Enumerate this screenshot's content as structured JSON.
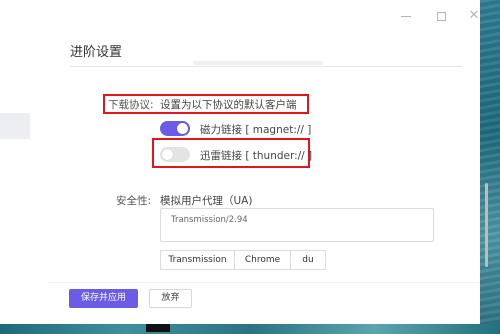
{
  "dialog": {
    "title": "进阶设置",
    "window_buttons": {
      "minimize": "",
      "maximize": "",
      "close": "✕"
    }
  },
  "protocol": {
    "label": "下载协议:",
    "description": "设置为以下协议的默认客户端",
    "options": [
      {
        "label": "磁力链接 [ magnet:// ]",
        "enabled": true
      },
      {
        "label": "迅雷链接 [ thunder:// ]",
        "enabled": false
      }
    ]
  },
  "security": {
    "label": "安全性:",
    "ua_title": "模拟用户代理（UA)",
    "ua_value": "Transmission/2.94",
    "presets": [
      "Transmission",
      "Chrome",
      "du"
    ]
  },
  "footer": {
    "save_label": "保存并应用",
    "discard_label": "放弃"
  },
  "colors": {
    "accent": "#6a5ce6",
    "highlight_box": "#e3151a"
  }
}
